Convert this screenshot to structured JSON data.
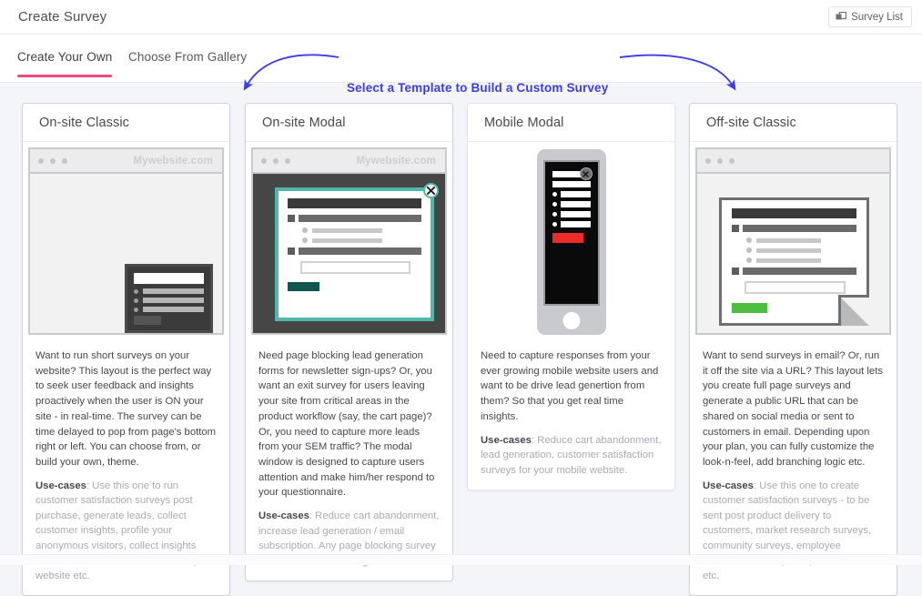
{
  "header": {
    "title": "Create Survey",
    "survey_list_label": "Survey List",
    "survey_list_icon": "stacked-cards-icon"
  },
  "tabs": [
    {
      "label": "Create Your Own",
      "active": true
    },
    {
      "label": "Choose From Gallery",
      "active": false
    }
  ],
  "annotation": {
    "text": "Select a Template to Build a Custom Survey",
    "color": "#3b3bf0",
    "style": "double-curved-arrow"
  },
  "colors": {
    "page_background": "#f4f5f9",
    "active_tab_underline": "#ef4b7f",
    "annotation_blue": "#3b3bf0",
    "modal_teal": "#52b6a8",
    "modal_submit_dark_teal": "#11564f",
    "mobile_button_red": "#ed2b2a",
    "offsite_button_green": "#4bbd3f"
  },
  "templates": [
    {
      "title": "On-site Classic",
      "thumb": {
        "type": "browser-widget",
        "url_label": "Mywebsite.com",
        "accent": "#545454"
      },
      "description": "Want to run short surveys on your website? This layout is the perfect way to seek user feedback and insights proactively when the user is ON your site - in real-time. The survey can be time delayed to pop from page's bottom right or left. You can choose from, or build your own, theme.",
      "usecase_label": "Use-cases",
      "usecase": ": Use this one to run customer satisfaction surveys post purchase, generate leads, collect customer insights, profile your anonymous visitors, collect insights from users who are about to leave your website etc."
    },
    {
      "title": "On-site Modal",
      "thumb": {
        "type": "browser-modal",
        "url_label": "Mywebsite.com",
        "accent": "#52b6a8",
        "close_icon": "close-x-icon"
      },
      "description": "Need page blocking lead generation forms for newsletter sign-ups? Or, you want an exit survey for users leaving your site from critical areas in the product workflow (say, the cart page)? Or, you need to capture more leads from your SEM traffic? The modal window is designed to capture users attention and make him/her respond to your questionnaire.",
      "usecase_label": "Use-cases",
      "usecase": ": Reduce cart abandonment, increase lead generation / email subscription. Any page blocking survey to collect customer insights."
    },
    {
      "title": "Mobile Modal",
      "thumb": {
        "type": "phone-modal",
        "url_label": "",
        "accent": "#ed2b2a",
        "close_icon": "close-x-icon"
      },
      "description": "Need to capture responses from your ever growing mobile website users and want to be drive lead genertion from them? So that you get real time insights.",
      "usecase_label": "Use-cases",
      "usecase": ": Reduce cart abandonment, lead generation, customer satisfaction surveys for your mobile website."
    },
    {
      "title": "Off-site Classic",
      "thumb": {
        "type": "browser-page-folded",
        "url_label": "",
        "accent": "#4bbd3f"
      },
      "description": "Want to send surveys in email? Or, run it off the site via a URL? This layout lets you create full page surveys and generate a public URL that can be shared on social media or sent to customers in email. Depending upon your plan, you can fully customize the look-n-feel, add branching logic etc.",
      "usecase_label": "Use-cases",
      "usecase": ": Use this one to create customer satisfaction surveys - to be sent post product delivery to customers, market research surveys, community surveys, employee satisfaction surveys on your intranet etc."
    }
  ]
}
